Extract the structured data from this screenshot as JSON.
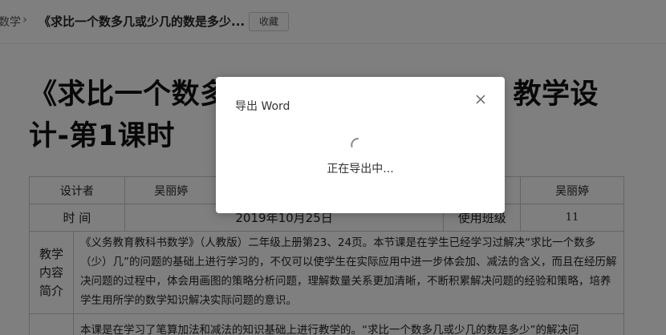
{
  "breadcrumb": {
    "prev": "数学",
    "separator": "›",
    "current": "《求比一个数多几或少几的数是多少..."
  },
  "toolbar": {
    "favorite_label": "收藏"
  },
  "document": {
    "title": "《求比一个数多几或少几的数是多少》教学设计-第1课时",
    "table": {
      "row1": {
        "designer_label": "设计者",
        "designer_value": "吴丽婷",
        "col3": "",
        "col4": "",
        "col5": "",
        "teacher_value": "吴丽婷"
      },
      "row2": {
        "time_label": "时  间",
        "time_value": "2019年10月25日",
        "class_label": "使用班级",
        "class_value": "11"
      },
      "intro": {
        "label": "教学内容简介",
        "text": "《义务教育教科书数学》（人教版）二年级上册第23、24页。本节课是在学生已经学习过解决“求比一个数多（少）几”的问题的基础上进行学习的，不仅可以使学生在实际应用中进一步体会加、减法的含义，而且在经历解决问题的过程中，体会用画图的策略分析问题，理解数量关系更加清晰，不断积累解决问题的经验和策略，培养学生用所学的数学知识解决实际问题的意识。"
      },
      "row4": {
        "text": "本课是在学习了笔算加法和减法的知识基础上进行教学的。“求比一个数多几或少几的数是多少”的解决问"
      }
    }
  },
  "modal": {
    "title": "导出 Word",
    "loading_text": "正在导出中..."
  },
  "colors": {
    "overlay": "rgba(0,0,0,0.5)",
    "modal_bg": "#ffffff",
    "border": "#c9c9c9"
  },
  "icons": {
    "close": "close-icon",
    "spinner": "spinner-icon",
    "chevron": "chevron-right-icon"
  }
}
